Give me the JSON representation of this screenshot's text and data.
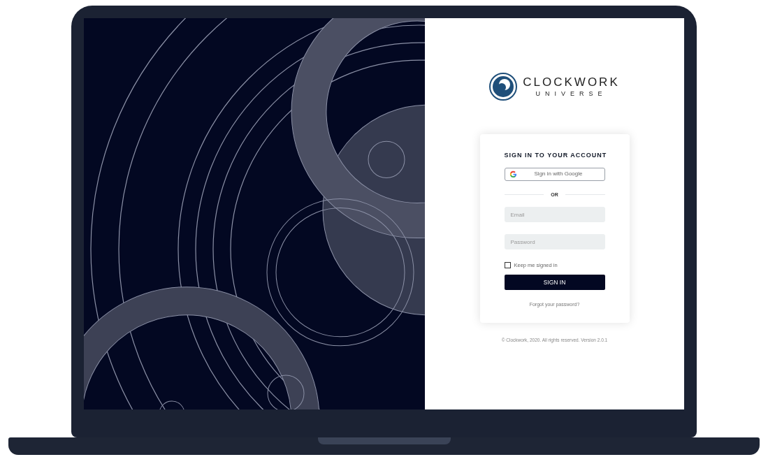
{
  "brand": {
    "name": "CLOCKWORK",
    "tagline": "UNIVERSE"
  },
  "login": {
    "title": "SIGN IN TO YOUR ACCOUNT",
    "google_button": "Sign in with Google",
    "divider": "OR",
    "email": {
      "placeholder": "Email"
    },
    "password": {
      "placeholder": "Password"
    },
    "remember": {
      "label": "Keep me signed in",
      "checked": false
    },
    "submit": "SIGN IN",
    "forgot": "Forgot your password?"
  },
  "footer": "© Clockwork, 2020. All rights reserved. Version 2.0.1"
}
